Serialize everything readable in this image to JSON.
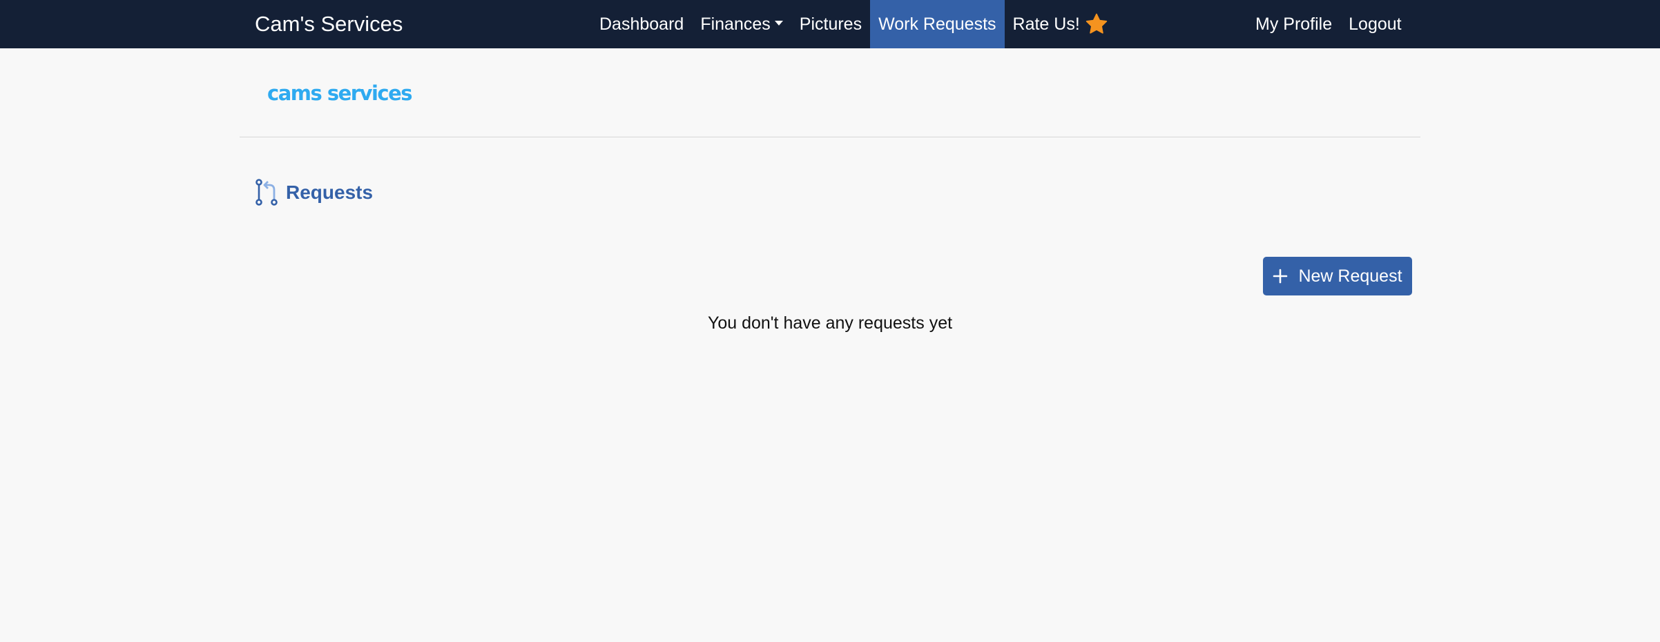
{
  "navbar": {
    "brand": "Cam's Services",
    "links": [
      {
        "label": "Dashboard"
      },
      {
        "label": "Finances"
      },
      {
        "label": "Pictures"
      },
      {
        "label": "Work Requests",
        "active": true
      },
      {
        "label": "Rate Us!"
      }
    ],
    "right_links": [
      {
        "label": "My Profile"
      },
      {
        "label": "Logout"
      }
    ],
    "active_color": "#3461a8",
    "background_color": "#142036",
    "star_icon": "star-icon",
    "star_color": "#f5931f"
  },
  "logo": {
    "text": "cams services",
    "color": "#2eaaf0"
  },
  "requests": {
    "icon": "git-pull-request-icon",
    "title": "Requests",
    "new_button_label": "New Request",
    "new_button_icon": "plus-icon",
    "empty_message": "You don't have any requests yet"
  }
}
